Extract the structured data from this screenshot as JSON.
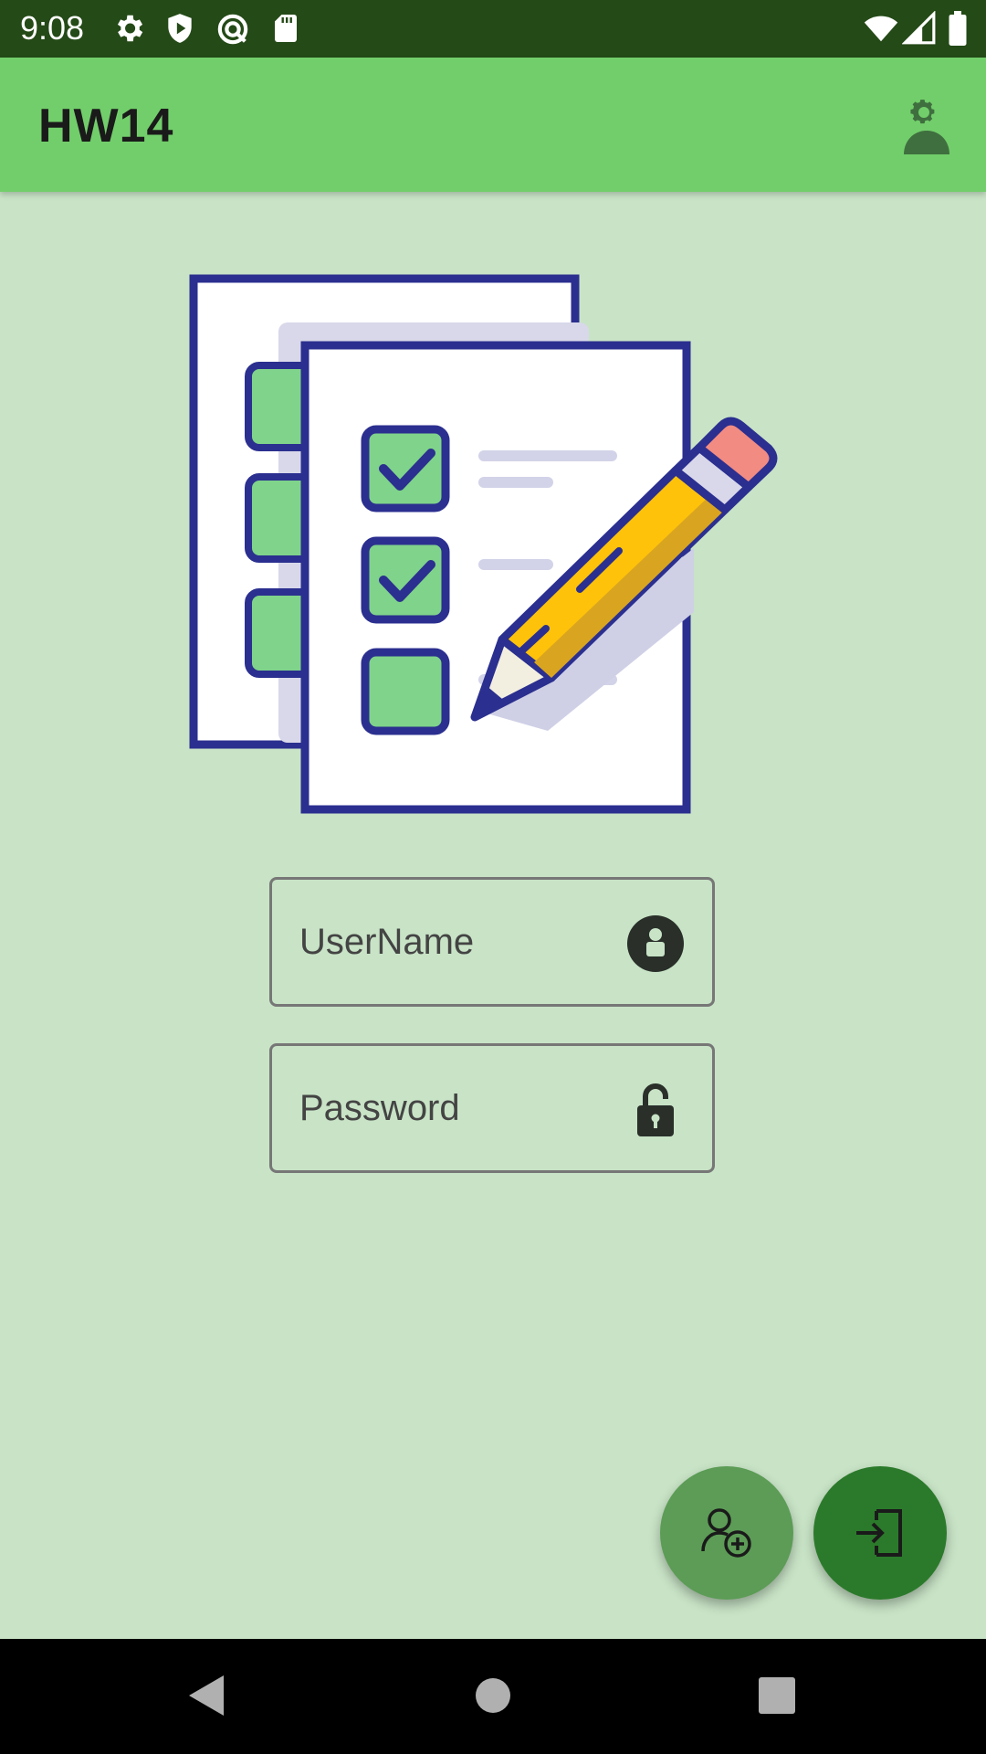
{
  "status_bar": {
    "time": "9:08",
    "icons": [
      "gear-icon",
      "shield-icon",
      "sync-icon",
      "sd-card-icon",
      "wifi-icon",
      "signal-icon",
      "battery-icon"
    ]
  },
  "app_bar": {
    "title": "HW14",
    "action_icon": "profile-settings-icon"
  },
  "login_form": {
    "username": {
      "placeholder": "UserName",
      "icon": "user-lock-icon"
    },
    "password": {
      "placeholder": "Password",
      "icon": "unlock-icon"
    }
  },
  "fabs": {
    "register": {
      "icon": "add-user-icon"
    },
    "login": {
      "icon": "login-icon"
    }
  },
  "colors": {
    "status_bar": "#244a17",
    "app_bar": "#72ce6b",
    "background": "#c8e3c6",
    "fab_register": "#5c9c56",
    "fab_login": "#2b7a2b"
  },
  "nav_bar": {
    "buttons": [
      "back-icon",
      "home-icon",
      "recents-icon"
    ]
  }
}
